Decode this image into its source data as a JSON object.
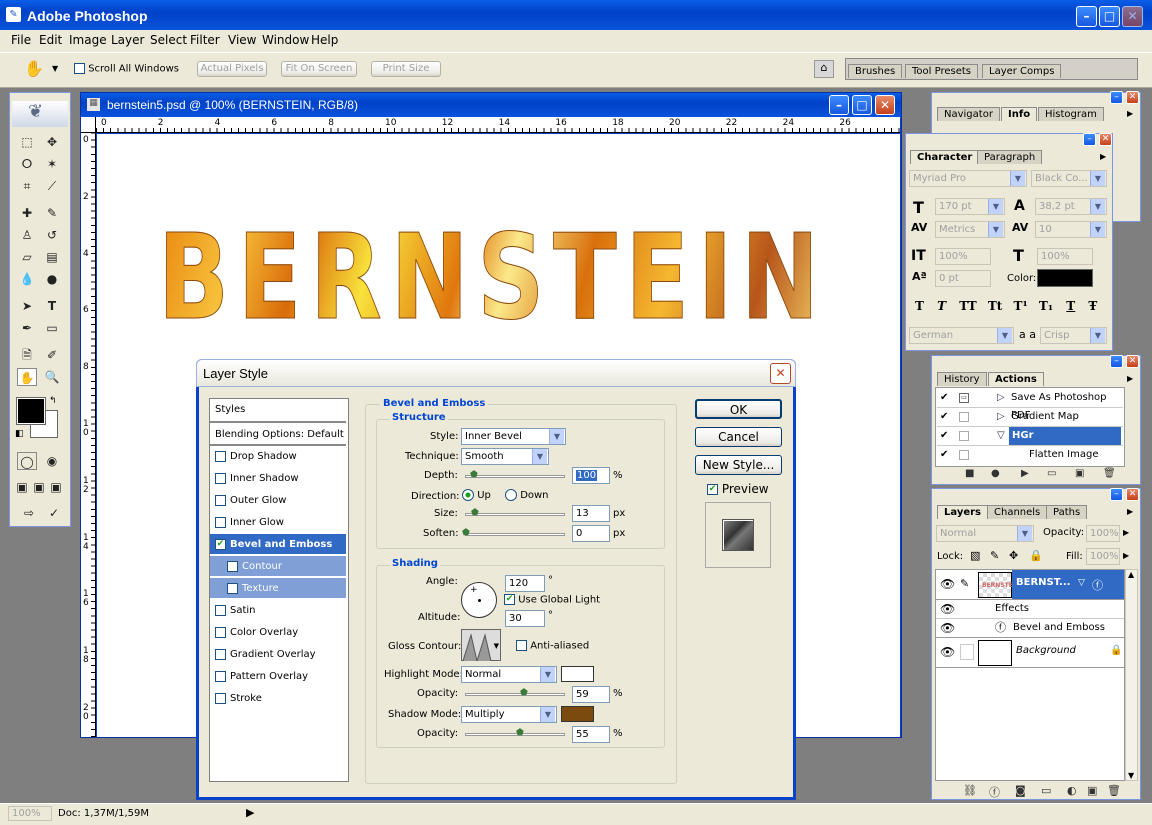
{
  "app": {
    "title": "Adobe Photoshop"
  },
  "menu": [
    "File",
    "Edit",
    "Image",
    "Layer",
    "Select",
    "Filter",
    "View",
    "Window",
    "Help"
  ],
  "options": {
    "scroll_all": "Scroll All Windows",
    "actual_pixels": "Actual Pixels",
    "fit_on_screen": "Fit On Screen",
    "print_size": "Print Size"
  },
  "well_tabs": [
    "Brushes",
    "Tool Presets",
    "Layer Comps"
  ],
  "document": {
    "title": "bernstein5.psd @ 100% (BERNSTEIN, RGB/8)",
    "art_text": "BERNSTEIN",
    "ruler_h": [
      "0",
      "2",
      "4",
      "6",
      "8",
      "10",
      "12",
      "14",
      "16",
      "18",
      "20",
      "22",
      "24",
      "26"
    ],
    "ruler_v": [
      "0",
      "2",
      "4",
      "6",
      "8",
      "10",
      "12",
      "14",
      "16",
      "18",
      "20"
    ]
  },
  "navigator_tabs": [
    "Navigator",
    "Info",
    "Histogram"
  ],
  "character": {
    "tabs": [
      "Character",
      "Paragraph"
    ],
    "font_family": "Myriad Pro",
    "font_style": "Black Co...",
    "size": "170 pt",
    "leading": "38,2 pt",
    "kerning": "Metrics",
    "tracking": "10",
    "vscale": "100%",
    "hscale": "100%",
    "baseline": "0 pt",
    "color_label": "Color:",
    "color": "#000000",
    "styles": [
      "T",
      "T",
      "TT",
      "Tt",
      "T¹",
      "T₁",
      "T",
      "Ŧ"
    ],
    "language": "German",
    "aa_label": "a a",
    "aa": "Crisp"
  },
  "history": {
    "tabs": [
      "History",
      "Actions"
    ],
    "items": [
      "Save As Photoshop PDF",
      "Gradient Map",
      "HGr",
      "Flatten Image"
    ]
  },
  "layers": {
    "tabs": [
      "Layers",
      "Channels",
      "Paths"
    ],
    "blend": "Normal",
    "opacity_label": "Opacity:",
    "opacity": "100%",
    "lock_label": "Lock:",
    "fill_label": "Fill:",
    "fill": "100%",
    "rows": [
      {
        "name": "BERNST..."
      },
      {
        "name": "Effects"
      },
      {
        "name": "Bevel and Emboss"
      },
      {
        "name": "Background"
      }
    ]
  },
  "layer_style": {
    "title": "Layer Style",
    "styles_header": "Styles",
    "blending": "Blending Options: Default",
    "list": [
      {
        "label": "Drop Shadow",
        "checked": false
      },
      {
        "label": "Inner Shadow",
        "checked": false
      },
      {
        "label": "Outer Glow",
        "checked": false
      },
      {
        "label": "Inner Glow",
        "checked": false
      },
      {
        "label": "Bevel and Emboss",
        "checked": true
      },
      {
        "label": "Contour",
        "checked": false
      },
      {
        "label": "Texture",
        "checked": false
      },
      {
        "label": "Satin",
        "checked": false
      },
      {
        "label": "Color Overlay",
        "checked": false
      },
      {
        "label": "Gradient Overlay",
        "checked": false
      },
      {
        "label": "Pattern Overlay",
        "checked": false
      },
      {
        "label": "Stroke",
        "checked": false
      }
    ],
    "section": "Bevel and Emboss",
    "structure": "Structure",
    "style_label": "Style:",
    "style": "Inner Bevel",
    "technique_label": "Technique:",
    "technique": "Smooth",
    "depth_label": "Depth:",
    "depth": "100",
    "depth_unit": "%",
    "direction_label": "Direction:",
    "up": "Up",
    "down": "Down",
    "size_label": "Size:",
    "size": "13",
    "size_unit": "px",
    "soften_label": "Soften:",
    "soften": "0",
    "soften_unit": "px",
    "shading": "Shading",
    "angle_label": "Angle:",
    "angle": "120",
    "deg": "°",
    "global_light": "Use Global Light",
    "altitude_label": "Altitude:",
    "altitude": "30",
    "gloss_label": "Gloss Contour:",
    "anti_aliased": "Anti-aliased",
    "highlight_label": "Highlight Mode:",
    "highlight_mode": "Normal",
    "highlight_color": "#ffffff",
    "opacity_label": "Opacity:",
    "highlight_opacity": "59",
    "shadow_opacity": "55",
    "pct": "%",
    "shadow_label": "Shadow Mode:",
    "shadow_mode": "Multiply",
    "shadow_color": "#7a4a0e",
    "ok": "OK",
    "cancel": "Cancel",
    "new_style": "New Style...",
    "preview": "Preview"
  },
  "status": {
    "zoom": "100%",
    "doc": "Doc: 1,37M/1,59M"
  }
}
